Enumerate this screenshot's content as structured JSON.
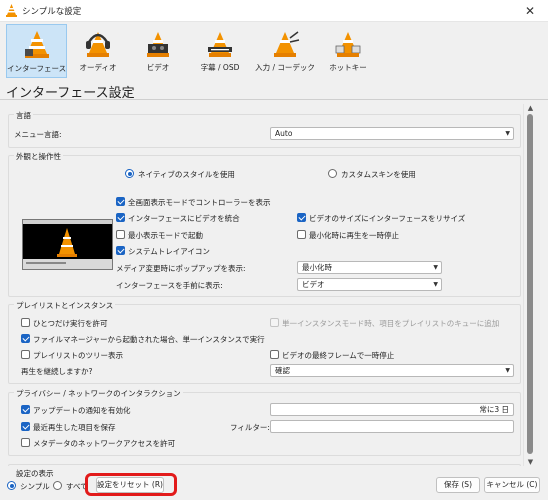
{
  "window": {
    "title": "シンプルな設定",
    "close_glyph": "✕"
  },
  "toolbar": [
    {
      "label": "インターフェース",
      "icon": "vlc-cone-interface-icon",
      "selected": true
    },
    {
      "label": "オーディオ",
      "icon": "headphones-cone-icon",
      "selected": false
    },
    {
      "label": "ビデオ",
      "icon": "video-cone-icon",
      "selected": false
    },
    {
      "label": "字幕 / OSD",
      "icon": "subtitles-cone-icon",
      "selected": false
    },
    {
      "label": "入力 / コーデック",
      "icon": "input-codec-cone-icon",
      "selected": false
    },
    {
      "label": "ホットキー",
      "icon": "hotkeys-cone-icon",
      "selected": false
    }
  ],
  "section_title": "インターフェース設定",
  "language": {
    "group": "言語",
    "label": "メニュー言語:",
    "value": "Auto"
  },
  "appearance": {
    "group": "外観と操作性",
    "radio_native": "ネイティブのスタイルを使用",
    "radio_custom": "カスタムスキンを使用",
    "native_selected": true,
    "checks": {
      "fullscreen_controller": {
        "label": "全画面表示モードでコントローラーを表示",
        "checked": true
      },
      "embed_video": {
        "label": "インターフェースにビデオを統合",
        "checked": true
      },
      "resize_to_video": {
        "label": "ビデオのサイズにインターフェースをリサイズ",
        "checked": true
      },
      "minimal_start": {
        "label": "最小表示モードで起動",
        "checked": false
      },
      "pause_minimized": {
        "label": "最小化時に再生を一時停止",
        "checked": false
      },
      "systray": {
        "label": "システムトレイアイコン",
        "checked": true
      }
    },
    "popup_label": "メディア変更時にポップアップを表示:",
    "popup_value": "最小化時",
    "raise_label": "インターフェースを手前に表示:",
    "raise_value": "ビデオ"
  },
  "playlist": {
    "group": "プレイリストとインスタンス",
    "one_instance": {
      "label": "ひとつだけ実行を許可",
      "checked": false
    },
    "enqueue": {
      "label": "単一インスタンスモード時、項目をプレイリストのキューに追加",
      "checked": false,
      "disabled": true
    },
    "file_manager": {
      "label": "ファイルマネージャーから起動された場合、単一インスタンスで実行",
      "checked": true
    },
    "tree": {
      "label": "プレイリストのツリー表示",
      "checked": false
    },
    "pause_last": {
      "label": "ビデオの最終フレームで一時停止",
      "checked": false
    },
    "resume_label": "再生を継続しますか?",
    "resume_value": "確認"
  },
  "privacy": {
    "group": "プライバシー / ネットワークのインタラクション",
    "update": {
      "label": "アップデートの通知を有効化",
      "checked": true
    },
    "update_value": "常に3 日",
    "recent": {
      "label": "最近再生した項目を保存",
      "checked": true
    },
    "filter_label": "フィルター:",
    "filter_value": "",
    "metadata": {
      "label": "メタデータのネットワークアクセスを許可",
      "checked": false
    }
  },
  "footer": {
    "show_settings": "設定の表示",
    "simple": "シンプル",
    "all": "すべて",
    "simple_selected": true,
    "reset": "設定をリセット (R)",
    "save": "保存 (S)",
    "cancel": "キャンセル (C)"
  },
  "colors": {
    "accent": "#1a64c4",
    "highlight": "#e21a1a",
    "selected_tab": "#cce4f7"
  }
}
